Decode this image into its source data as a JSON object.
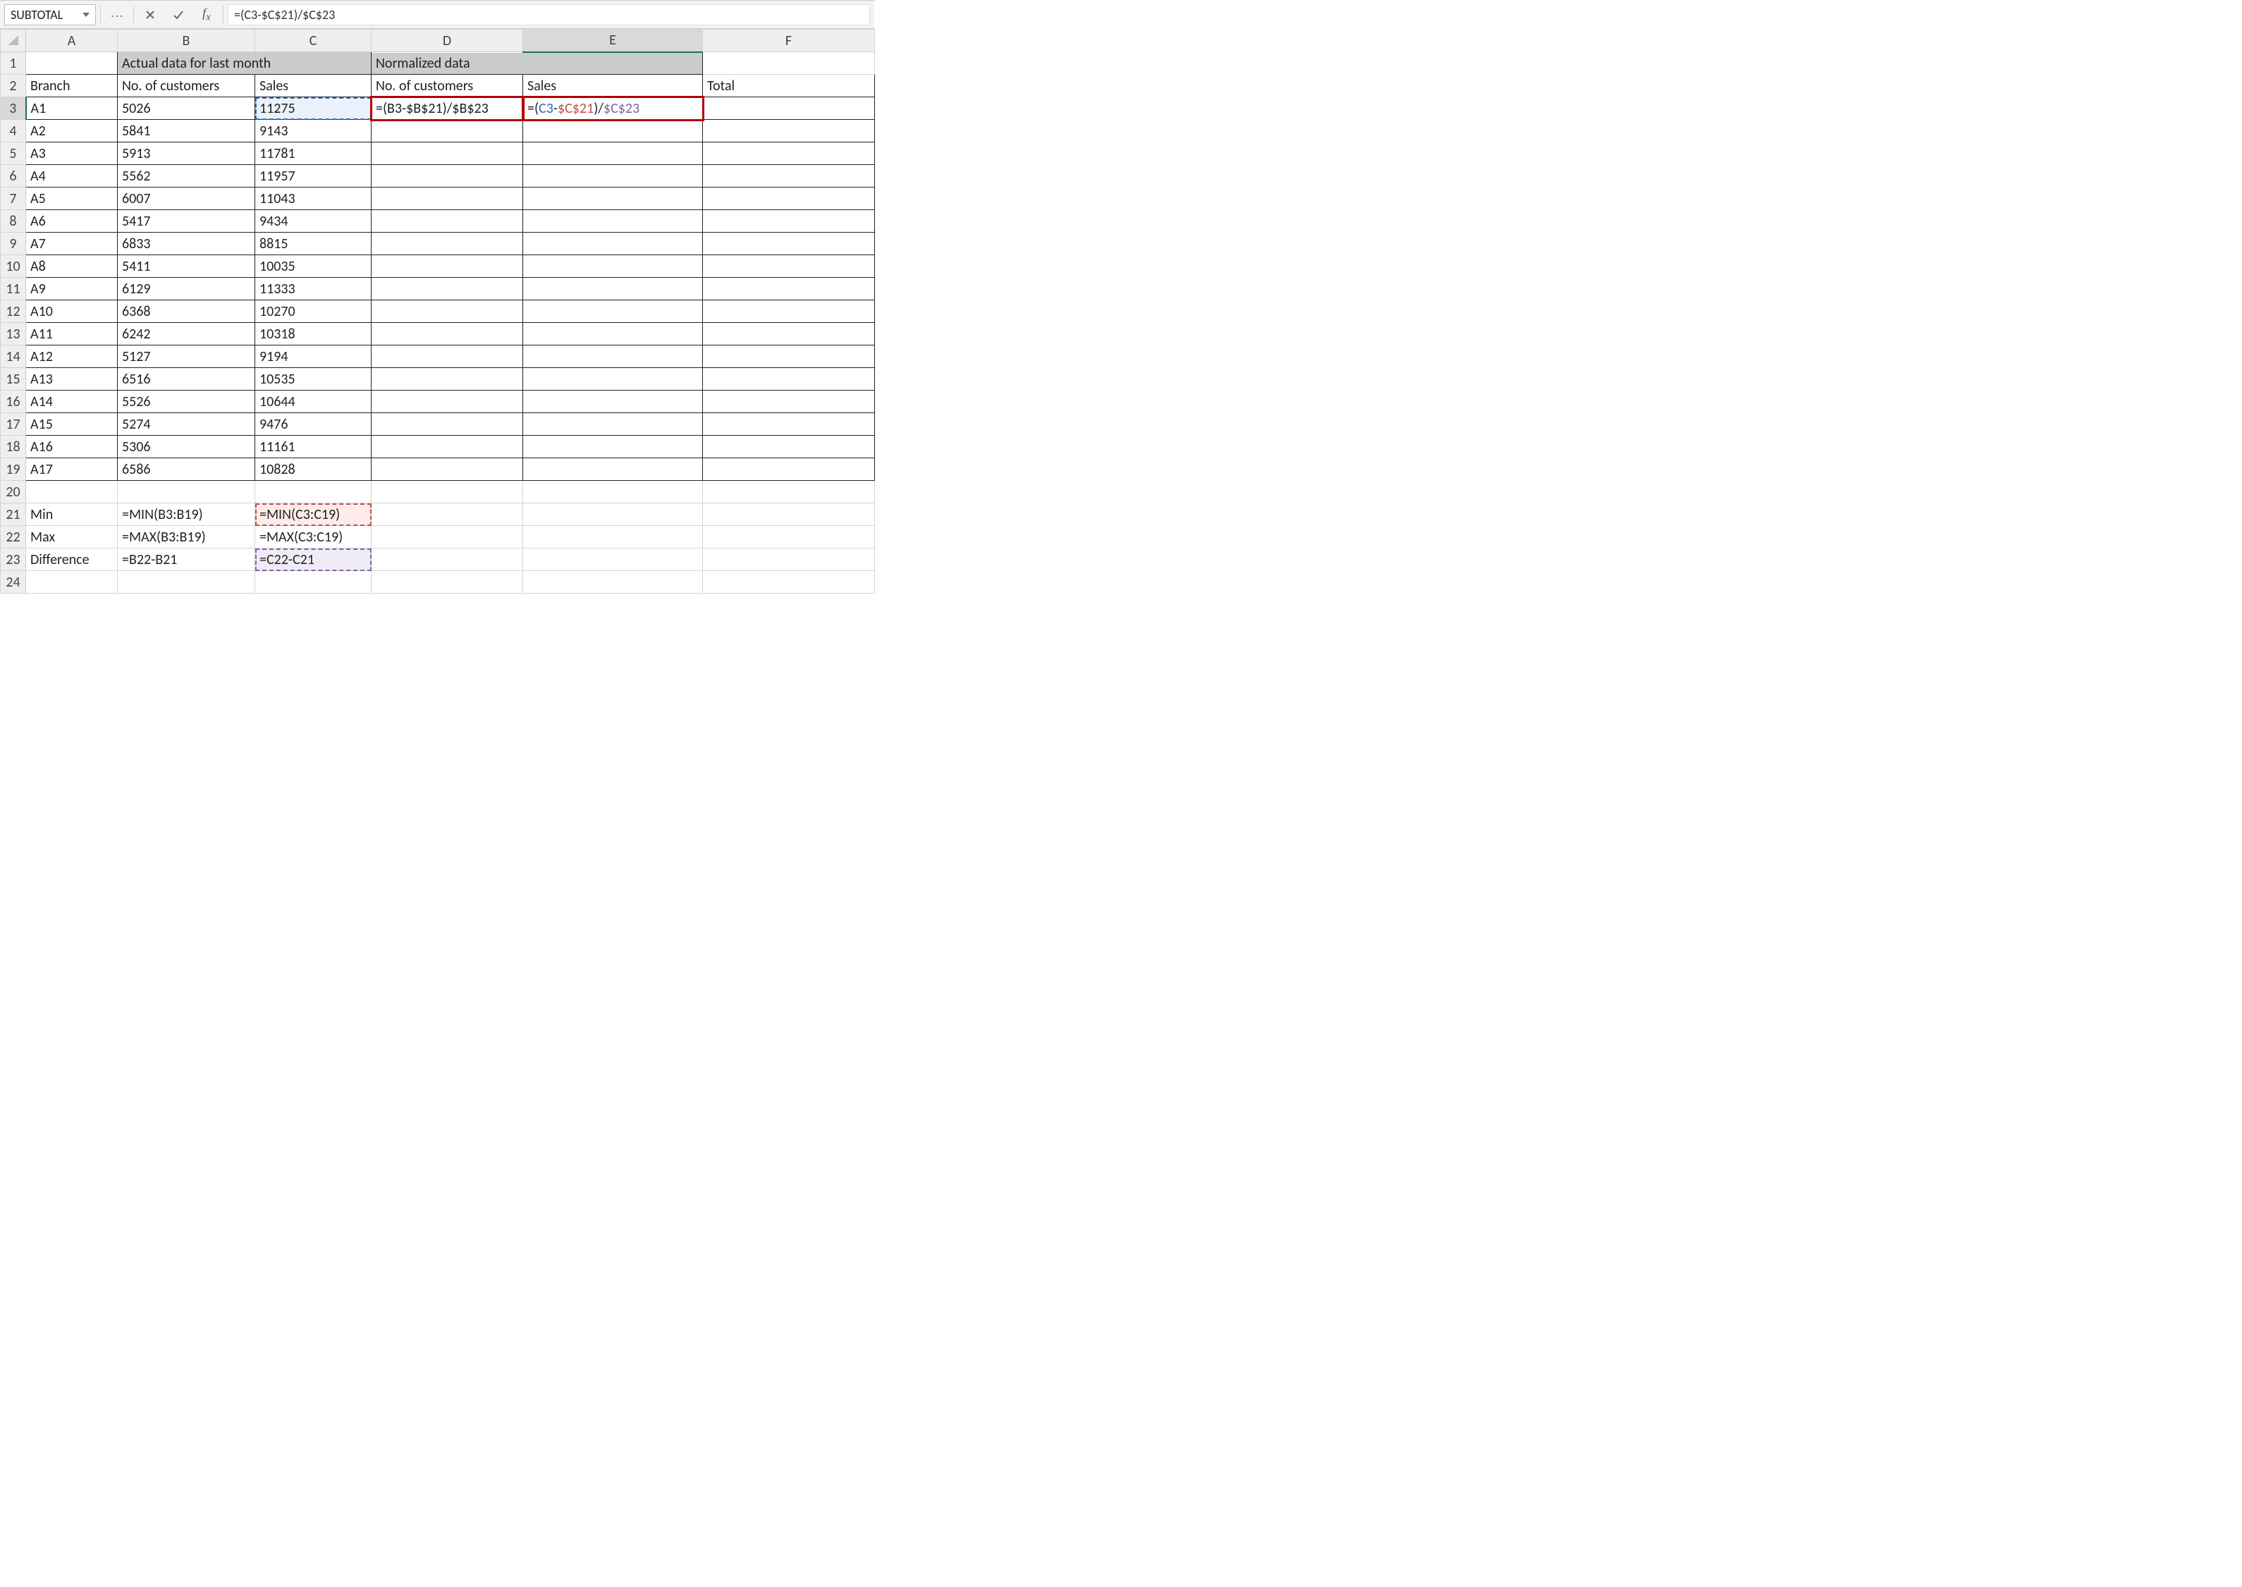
{
  "nameBox": "SUBTOTAL",
  "formula": "=(C3-$C$21)/$C$23",
  "colHeaders": [
    "A",
    "B",
    "C",
    "D",
    "E",
    "F"
  ],
  "activeCol": "E",
  "activeRow": 3,
  "mergedHeaders": {
    "bc1": "Actual data for last month",
    "de1": "Normalized data"
  },
  "row2": {
    "A": "Branch",
    "B": "No. of customers",
    "C": "Sales",
    "D": "No. of customers",
    "E": "Sales",
    "F": "Total"
  },
  "row3": {
    "A": "A1",
    "B": "5026",
    "C": "11275",
    "D": "=(B3-$B$21)/$B$23",
    "E_plain": "=(C3-$C$21)/$C$23"
  },
  "dataRows": [
    {
      "r": 4,
      "A": "A2",
      "B": "5841",
      "C": "9143"
    },
    {
      "r": 5,
      "A": "A3",
      "B": "5913",
      "C": "11781"
    },
    {
      "r": 6,
      "A": "A4",
      "B": "5562",
      "C": "11957"
    },
    {
      "r": 7,
      "A": "A5",
      "B": "6007",
      "C": "11043"
    },
    {
      "r": 8,
      "A": "A6",
      "B": "5417",
      "C": "9434"
    },
    {
      "r": 9,
      "A": "A7",
      "B": "6833",
      "C": "8815"
    },
    {
      "r": 10,
      "A": "A8",
      "B": "5411",
      "C": "10035"
    },
    {
      "r": 11,
      "A": "A9",
      "B": "6129",
      "C": "11333"
    },
    {
      "r": 12,
      "A": "A10",
      "B": "6368",
      "C": "10270"
    },
    {
      "r": 13,
      "A": "A11",
      "B": "6242",
      "C": "10318"
    },
    {
      "r": 14,
      "A": "A12",
      "B": "5127",
      "C": "9194"
    },
    {
      "r": 15,
      "A": "A13",
      "B": "6516",
      "C": "10535"
    },
    {
      "r": 16,
      "A": "A14",
      "B": "5526",
      "C": "10644"
    },
    {
      "r": 17,
      "A": "A15",
      "B": "5274",
      "C": "9476"
    },
    {
      "r": 18,
      "A": "A16",
      "B": "5306",
      "C": "11161"
    },
    {
      "r": 19,
      "A": "A17",
      "B": "6586",
      "C": "10828"
    }
  ],
  "row21": {
    "A": "Min",
    "B": "=MIN(B3:B19)",
    "C": "=MIN(C3:C19)"
  },
  "row22": {
    "A": "Max",
    "B": "=MAX(B3:B19)",
    "C": "=MAX(C3:C19)"
  },
  "row23": {
    "A": "Difference",
    "B": "=B22-B21",
    "C": "=C22-C21"
  }
}
